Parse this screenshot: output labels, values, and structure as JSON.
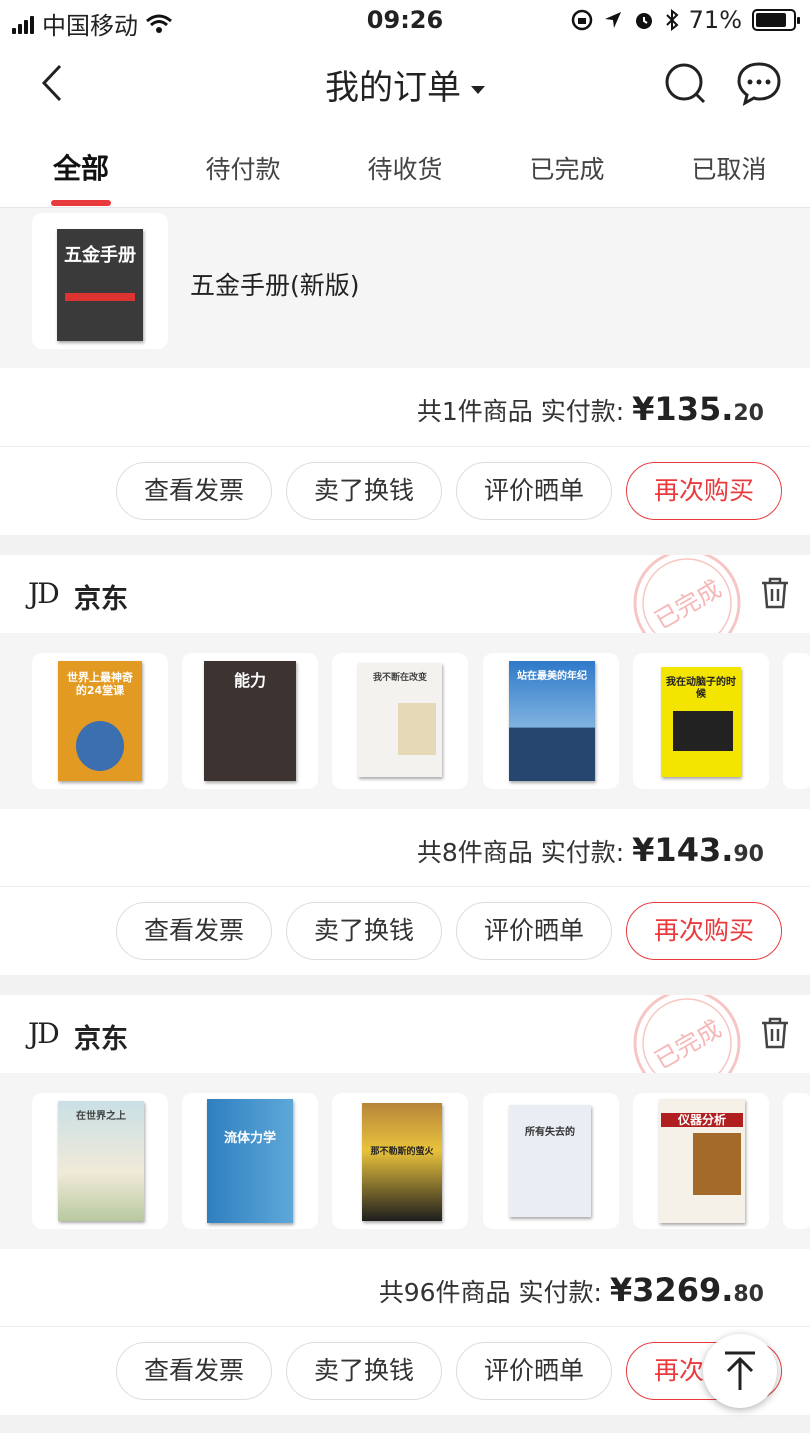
{
  "status_bar": {
    "carrier": "中国移动",
    "time": "09:26",
    "battery": "71%",
    "battery_level": 0.71
  },
  "header": {
    "title": "我的订单"
  },
  "tabs": [
    "全部",
    "待付款",
    "待收货",
    "已完成",
    "已取消"
  ],
  "orders": [
    {
      "product_name": "五金手册(新版)",
      "summary_label": "共1件商品  实付款:",
      "price_int": "¥135.",
      "price_dec": "20",
      "book_cover_text": "五金手册"
    },
    {
      "store": "京东",
      "stamp": "已完成",
      "summary_label": "共8件商品  实付款:",
      "price_int": "¥143.",
      "price_dec": "90",
      "covers": [
        "世界上最神奇的24堂课",
        "能力",
        "我不断在改变",
        "站在最美的年纪",
        "我在动脑子的时候"
      ]
    },
    {
      "store": "京东",
      "stamp": "已完成",
      "summary_label": "共96件商品  实付款:",
      "price_int": "¥3269.",
      "price_dec": "80",
      "covers": [
        "在世界之上",
        "流体力学",
        "那不勒斯的萤火",
        "所有失去的",
        "仪器分析"
      ]
    }
  ],
  "buttons": {
    "invoice": "查看发票",
    "sell": "卖了换钱",
    "review": "评价晒单",
    "rebuy": "再次购买"
  },
  "colors": {
    "accent": "#e93b3d",
    "background": "#f2f2f2"
  }
}
